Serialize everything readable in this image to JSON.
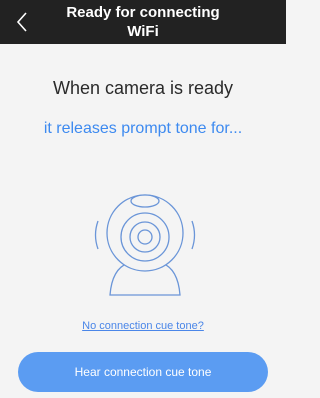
{
  "header": {
    "title": "Ready for connecting\nWiFi",
    "back_icon": "chevron-left-icon"
  },
  "main": {
    "headline": "When camera is ready",
    "subline": "it releases prompt tone for...",
    "illustration_icon": "webcam-icon",
    "help_link": "No connection cue tone?",
    "primary_button": "Hear connection cue tone"
  },
  "colors": {
    "header_bg": "#222222",
    "accent": "#3d8af0",
    "button_bg": "#5b9cf2",
    "page_bg": "#f4f4f4"
  }
}
